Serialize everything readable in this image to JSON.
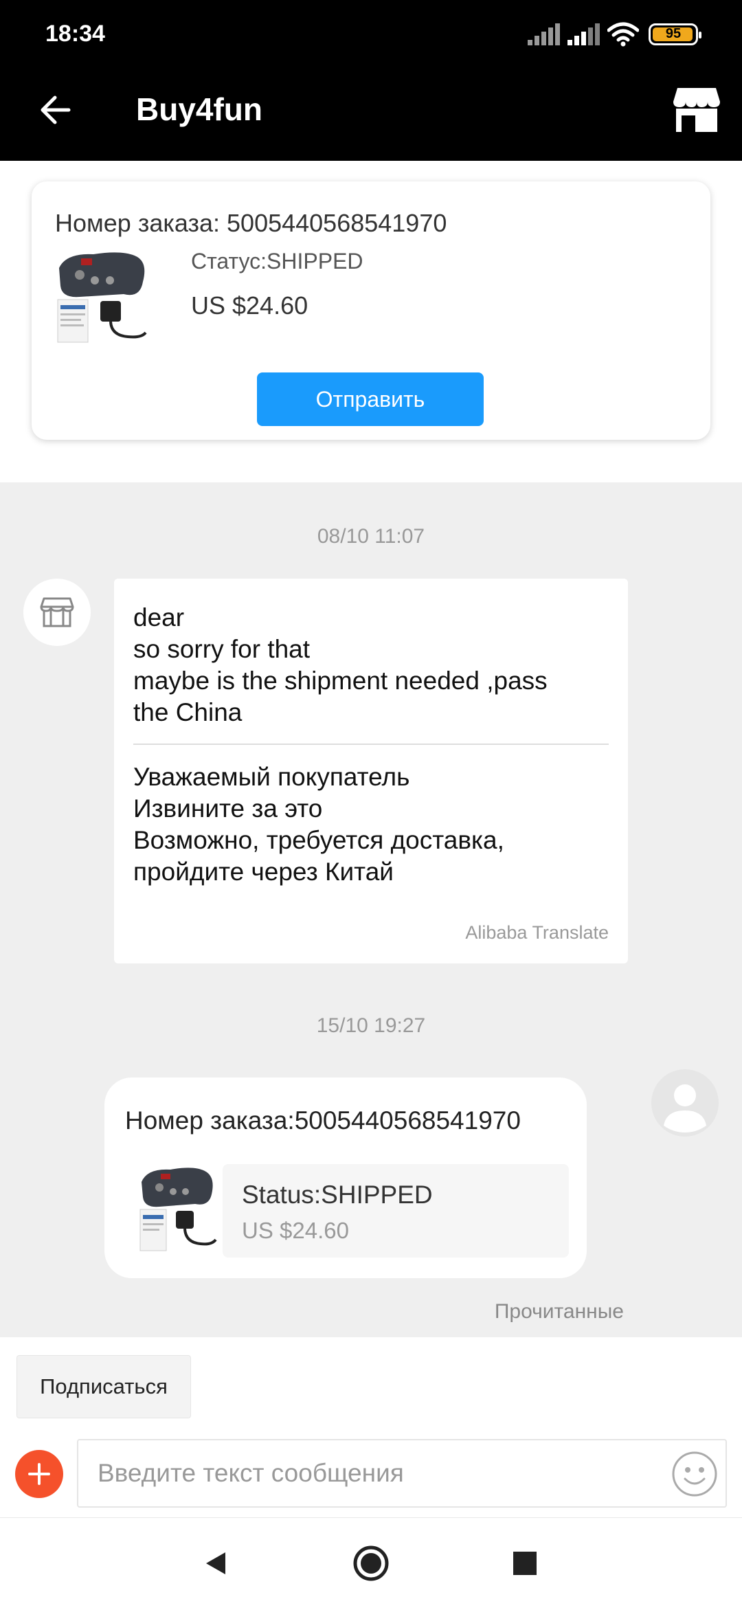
{
  "status_bar": {
    "time": "18:34",
    "battery": "95",
    "icons": [
      "signal-icon",
      "signal-icon",
      "wifi-icon",
      "battery-icon"
    ]
  },
  "app_bar": {
    "title": "Buy4fun",
    "back_icon": "arrow-left-icon",
    "store_icon": "store-icon"
  },
  "order_card": {
    "number": "Номер заказа: 5005440568541970",
    "status": "Статус:SHIPPED",
    "price": "US $24.60",
    "send_label": "Отправить"
  },
  "chat": {
    "messages": [
      {
        "timestamp": "08/10 11:07",
        "sender": "seller",
        "original": "dear\nso sorry for that\nmaybe is the shipment needed ,pass\nthe China",
        "translated": "Уважаемый покупатель\nИзвините за это\nВозможно, требуется доставка,\nпройдите через Китай",
        "translate_note": "Alibaba Translate"
      },
      {
        "timestamp": "15/10 19:27",
        "sender": "me",
        "order_number": "Номер заказа:5005440568541970",
        "order_status": "Status:SHIPPED",
        "order_price": "US $24.60",
        "read_status": "Прочитанные"
      }
    ]
  },
  "bottom": {
    "subscribe_label": "Подписаться",
    "input_placeholder": "Введите текст сообщения",
    "input_value": ""
  },
  "colors": {
    "accent_blue": "#1a9bfc",
    "plus_orange": "#f5512b",
    "battery": "#f0a81c"
  }
}
